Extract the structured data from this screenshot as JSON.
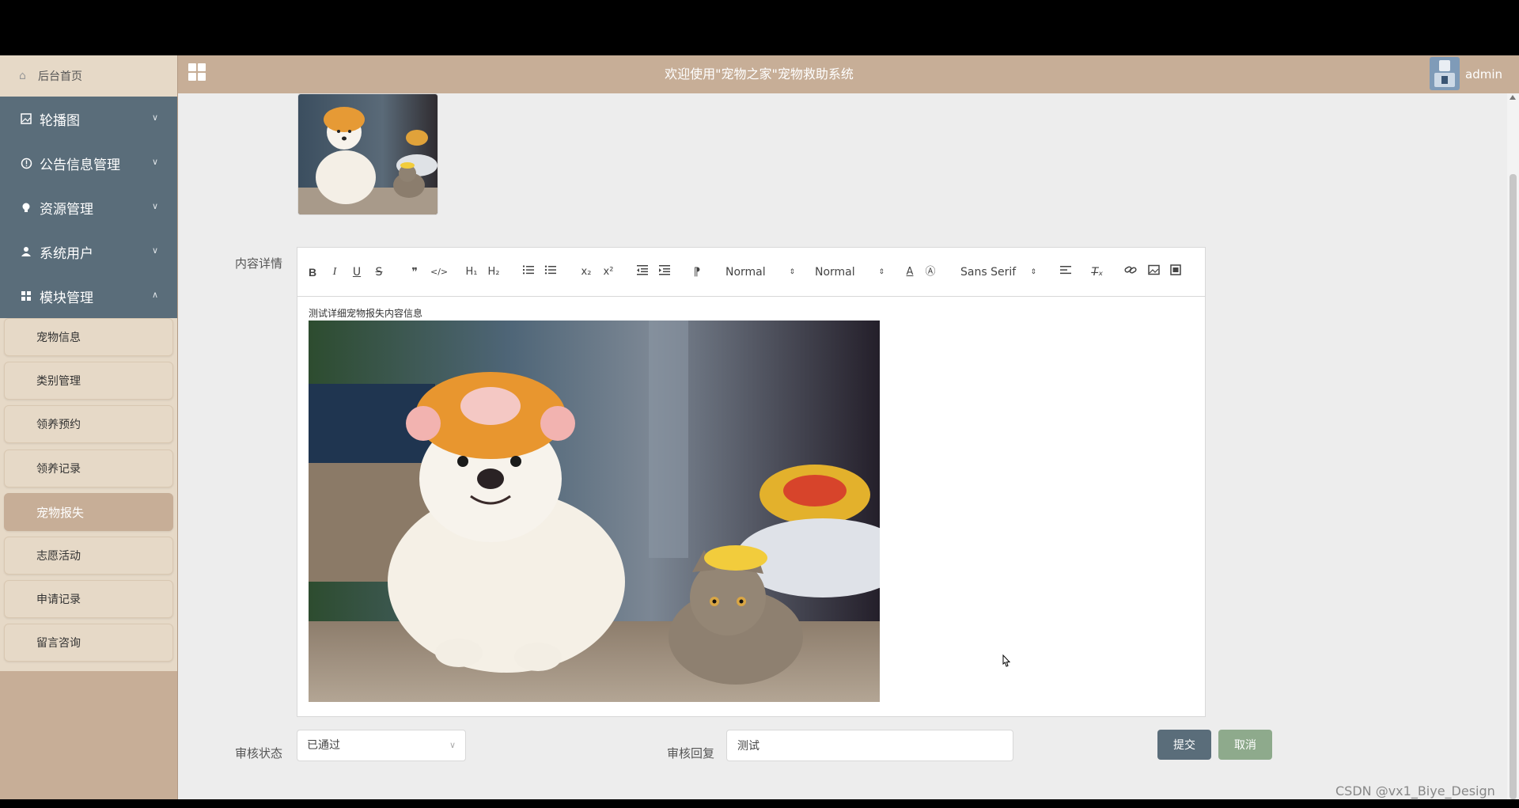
{
  "header": {
    "title": "欢迎使用\"宠物之家\"宠物救助系统",
    "username": "admin",
    "grid_icon": "grid-icon",
    "avatar_icon": "avatar"
  },
  "sidebar": {
    "home": {
      "label": "后台首页",
      "icon": "home-icon"
    },
    "groups": [
      {
        "label": "轮播图",
        "icon": "image-icon",
        "expanded": false
      },
      {
        "label": "公告信息管理",
        "icon": "info-icon",
        "expanded": false
      },
      {
        "label": "资源管理",
        "icon": "bulb-icon",
        "expanded": false
      },
      {
        "label": "系统用户",
        "icon": "user-icon",
        "expanded": false
      },
      {
        "label": "模块管理",
        "icon": "grid-icon",
        "expanded": true
      }
    ],
    "sub_items": [
      {
        "label": "宠物信息",
        "active": false
      },
      {
        "label": "类别管理",
        "active": false
      },
      {
        "label": "领养预约",
        "active": false
      },
      {
        "label": "领养记录",
        "active": false
      },
      {
        "label": "宠物报失",
        "active": true
      },
      {
        "label": "志愿活动",
        "active": false
      },
      {
        "label": "申请记录",
        "active": false
      },
      {
        "label": "留言咨询",
        "active": false
      }
    ]
  },
  "form": {
    "content_label": "内容详情",
    "editor": {
      "header_select": "Normal",
      "size_select": "Normal",
      "font_select": "Sans Serif",
      "text": "测试详细宠物报失内容信息"
    },
    "status": {
      "label": "审核状态",
      "value": "已通过"
    },
    "reply": {
      "label": "审核回复",
      "value": "测试"
    },
    "submit_label": "提交",
    "cancel_label": "取消"
  },
  "colors": {
    "sidebar_tan": "#c7ae97",
    "sidebar_dark": "#5a6d7a",
    "sub_item_bg": "#e6d9c7",
    "submit": "#5a6d7a",
    "cancel": "#8eaa8c"
  },
  "watermark": "CSDN @vx1_Biye_Design"
}
